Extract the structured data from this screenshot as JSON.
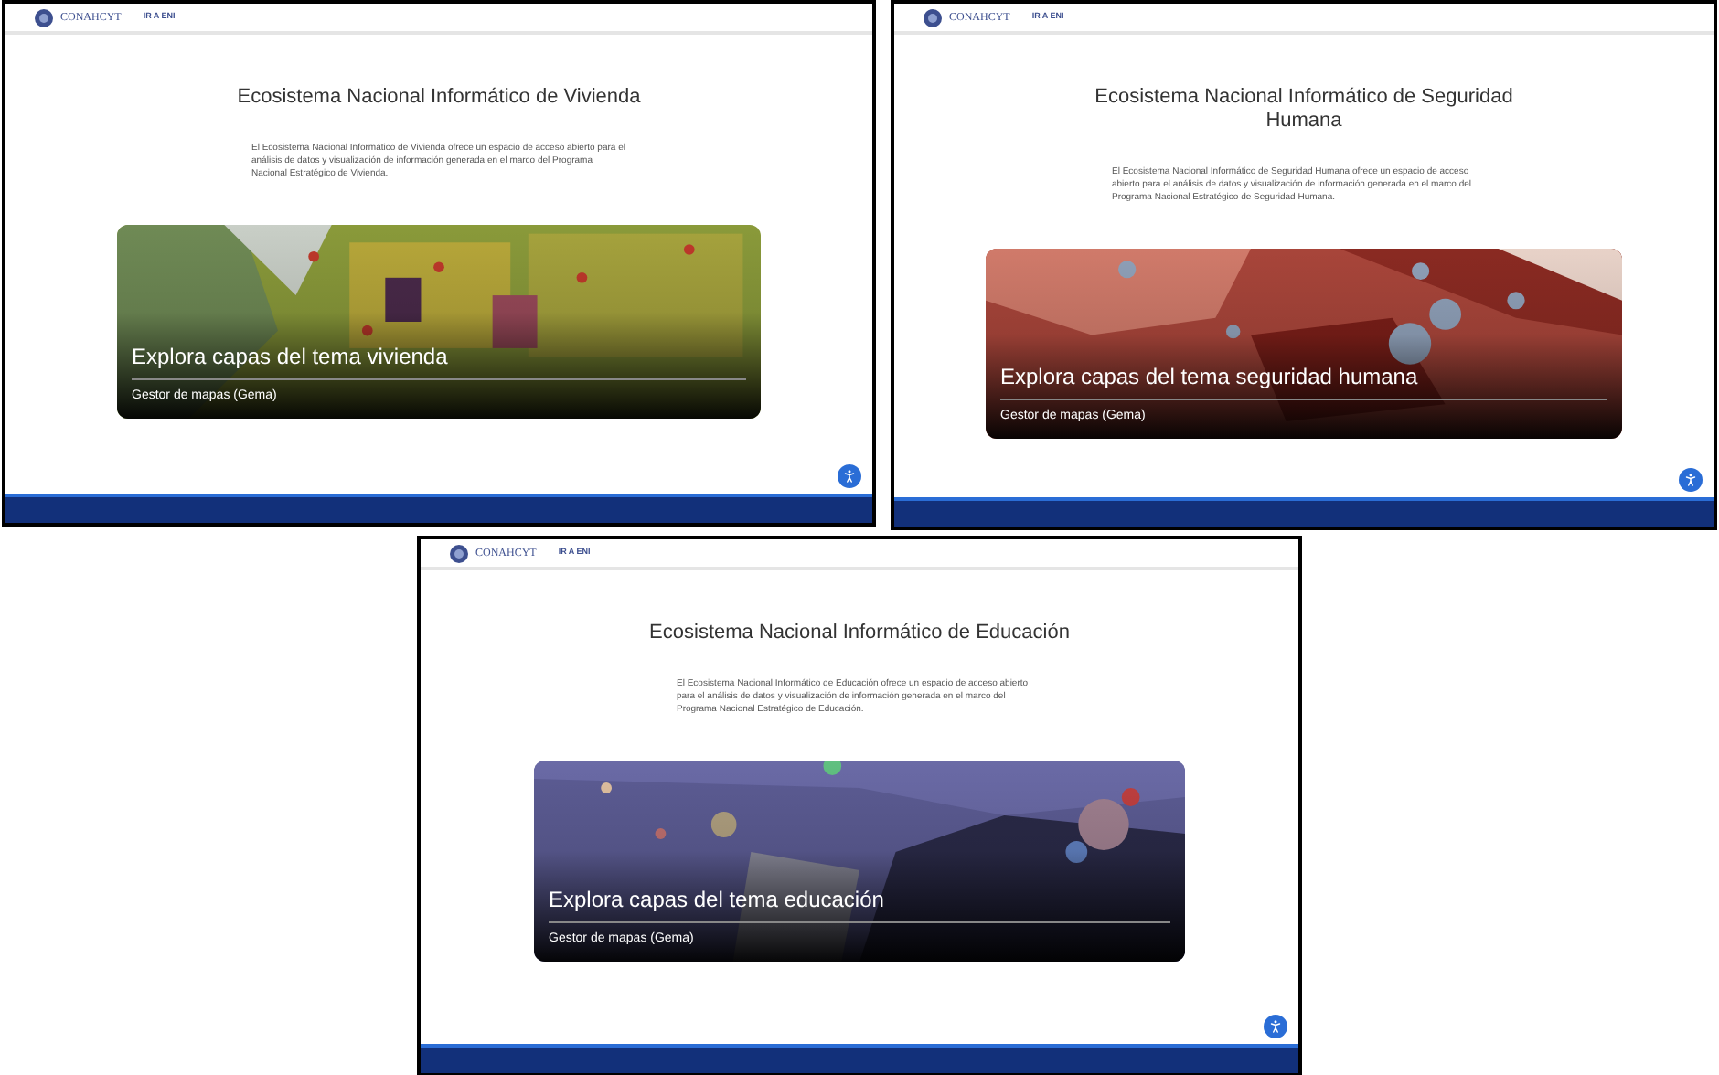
{
  "screens": [
    {
      "header": {
        "brand": "CONAHCYT",
        "link": "IR A ENI"
      },
      "title": "Ecosistema Nacional Informático de Vivienda",
      "description": "El Ecosistema Nacional Informático de Vivienda ofrece un espacio de acceso abierto para el análisis de datos y visualización de información generada en el marco del Programa Nacional Estratégico de Vivienda.",
      "card": {
        "title": "Explora capas del tema vivienda",
        "subtitle": "Gestor de mapas (Gema)"
      }
    },
    {
      "header": {
        "brand": "CONAHCYT",
        "link": "IR A ENI"
      },
      "title": "Ecosistema Nacional Informático de Seguridad Humana",
      "description": "El Ecosistema Nacional Informático de Seguridad Humana ofrece un espacio de acceso abierto para el análisis de datos y visualización de información generada en el marco del Programa Nacional Estratégico de Seguridad Humana.",
      "card": {
        "title": "Explora capas del tema seguridad humana",
        "subtitle": "Gestor de mapas (Gema)"
      }
    },
    {
      "header": {
        "brand": "CONAHCYT",
        "link": "IR A ENI"
      },
      "title": "Ecosistema Nacional Informático de Educación",
      "description": "El Ecosistema Nacional Informático de Educación ofrece un espacio de acceso abierto para el análisis de datos y visualización de información generada en el marco del Programa Nacional Estratégico de Educación.",
      "card": {
        "title": "Explora capas del tema educación",
        "subtitle": "Gestor de mapas (Gema)"
      }
    }
  ]
}
